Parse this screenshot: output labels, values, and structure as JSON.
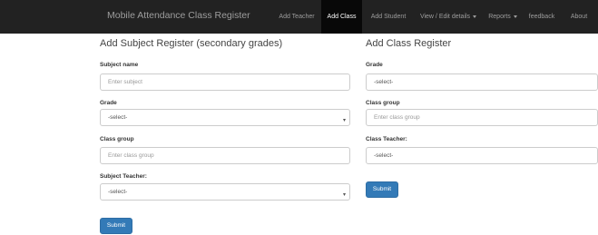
{
  "navbar": {
    "brand": "Mobile Attendance Class Register",
    "items": [
      {
        "label": "Add Teacher",
        "active": false,
        "dropdown": false
      },
      {
        "label": "Add Class",
        "active": true,
        "dropdown": false
      },
      {
        "label": "Add Student",
        "active": false,
        "dropdown": false
      },
      {
        "label": "View / Edit details",
        "active": false,
        "dropdown": true
      },
      {
        "label": "Reports",
        "active": false,
        "dropdown": true
      },
      {
        "label": "feedback",
        "active": false,
        "dropdown": false
      },
      {
        "label": "About",
        "active": false,
        "dropdown": false
      }
    ]
  },
  "subject_form": {
    "heading": "Add Subject Register (secondary grades)",
    "subject_name": {
      "label": "Subject name",
      "placeholder": "Enter subject"
    },
    "grade": {
      "label": "Grade",
      "value": "-select-"
    },
    "class_group": {
      "label": "Class group",
      "placeholder": "Enter class group"
    },
    "subject_teacher": {
      "label": "Subject Teacher:",
      "value": "-select-"
    },
    "submit": "Submit"
  },
  "class_form": {
    "heading": "Add Class Register",
    "grade": {
      "label": "Grade",
      "value": "-select-"
    },
    "class_group": {
      "label": "Class group",
      "placeholder": "Enter class group"
    },
    "class_teacher": {
      "label": "Class Teacher:",
      "value": "-select-"
    },
    "submit": "Submit"
  },
  "colors": {
    "navbar": "#222222",
    "active_nav": "#080808",
    "primary_button": "#337ab7"
  }
}
